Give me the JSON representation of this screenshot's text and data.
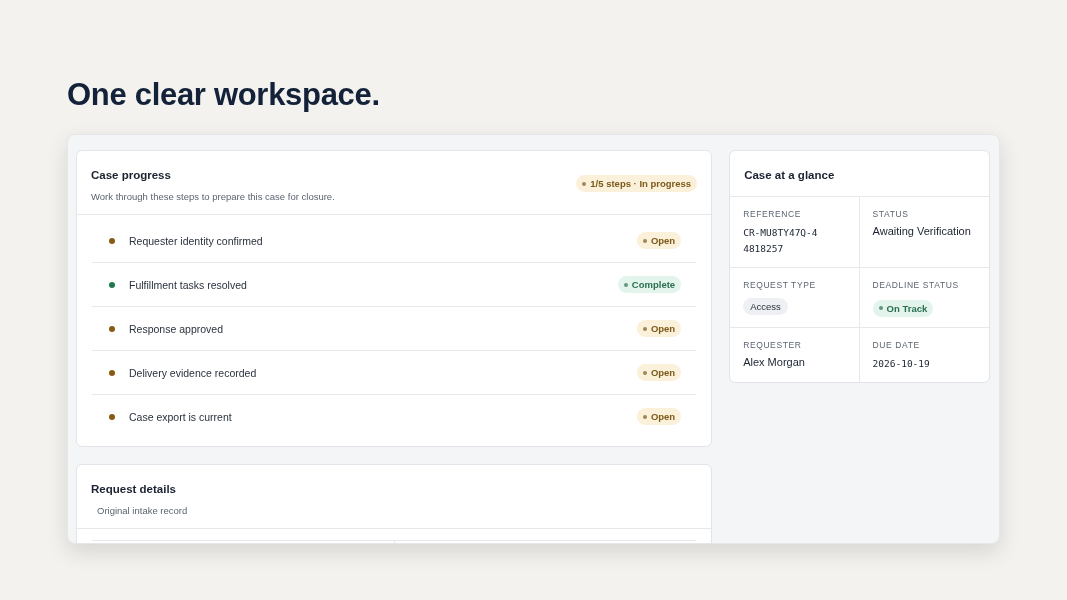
{
  "headline": "One clear workspace.",
  "progress": {
    "title": "Case progress",
    "subtitle": "Work through these steps to prepare this case for closure.",
    "badge": "1/5 steps · In progress",
    "steps": [
      {
        "label": "Requester identity confirmed",
        "status": "Open",
        "kind": "open"
      },
      {
        "label": "Fulfillment tasks resolved",
        "status": "Complete",
        "kind": "complete"
      },
      {
        "label": "Response approved",
        "status": "Open",
        "kind": "open"
      },
      {
        "label": "Delivery evidence recorded",
        "status": "Open",
        "kind": "open"
      },
      {
        "label": "Case export is current",
        "status": "Open",
        "kind": "open"
      }
    ]
  },
  "request_details": {
    "title": "Request details",
    "subtitle": "Original intake record"
  },
  "glance": {
    "title": "Case at a glance",
    "fields": [
      {
        "label": "REFERENCE",
        "value": "CR-MU8TY47Q-44818257",
        "kind": "mono"
      },
      {
        "label": "STATUS",
        "value": "Awaiting Verification",
        "kind": "text"
      },
      {
        "label": "REQUEST TYPE",
        "value": "Access",
        "kind": "tag"
      },
      {
        "label": "DEADLINE STATUS",
        "value": "On Track",
        "kind": "pill"
      },
      {
        "label": "REQUESTER",
        "value": "Alex Morgan",
        "kind": "text"
      },
      {
        "label": "DUE DATE",
        "value": "2026-10-19",
        "kind": "mono"
      }
    ]
  }
}
